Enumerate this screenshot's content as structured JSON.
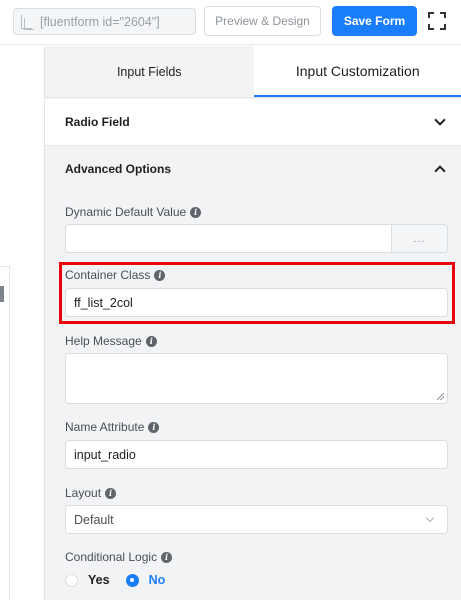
{
  "toolbar": {
    "shortcode": "[fluentform id=\"2604\"]",
    "preview_label": "Preview & Design",
    "save_label": "Save Form",
    "accent_color": "#1a7efb"
  },
  "tabs": [
    {
      "label": "Input Fields",
      "active": false
    },
    {
      "label": "Input Customization",
      "active": true
    }
  ],
  "sections": {
    "radio_field": {
      "title": "Radio Field",
      "expanded": false
    },
    "advanced": {
      "title": "Advanced Options",
      "expanded": true
    }
  },
  "fields": {
    "dynamic_default": {
      "label": "Dynamic Default Value",
      "value": "",
      "button": "..."
    },
    "container_class": {
      "label": "Container Class",
      "value": "ff_list_2col",
      "highlight_color": "#e8000b"
    },
    "help_message": {
      "label": "Help Message",
      "value": ""
    },
    "name_attribute": {
      "label": "Name Attribute",
      "value": "input_radio"
    },
    "layout": {
      "label": "Layout",
      "value": "Default"
    },
    "conditional_logic": {
      "label": "Conditional Logic",
      "options": [
        {
          "label": "Yes",
          "checked": false
        },
        {
          "label": "No",
          "checked": true
        }
      ]
    }
  }
}
